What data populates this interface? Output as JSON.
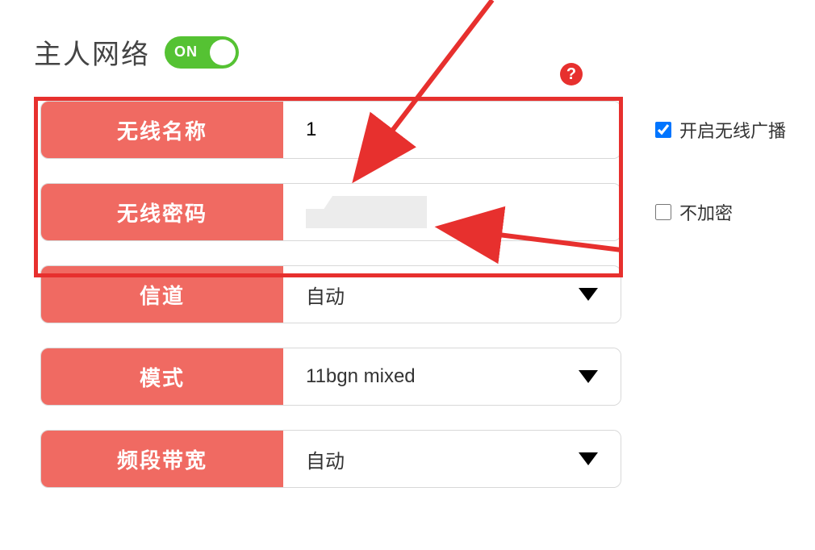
{
  "header": {
    "title": "主人网络",
    "toggle_label": "ON",
    "help_label": "?"
  },
  "fields": {
    "ssid": {
      "label": "无线名称",
      "value": "1"
    },
    "password": {
      "label": "无线密码",
      "value": ""
    },
    "channel": {
      "label": "信道",
      "value": "自动"
    },
    "mode": {
      "label": "模式",
      "value": "11bgn mixed"
    },
    "bandwidth": {
      "label": "频段带宽",
      "value": "自动"
    }
  },
  "options": {
    "broadcast": {
      "label": "开启无线广播",
      "checked": true
    },
    "no_encrypt": {
      "label": "不加密",
      "checked": false
    }
  },
  "colors": {
    "accent": "#f06a62",
    "toggle": "#55c233",
    "danger": "#e7302e"
  }
}
